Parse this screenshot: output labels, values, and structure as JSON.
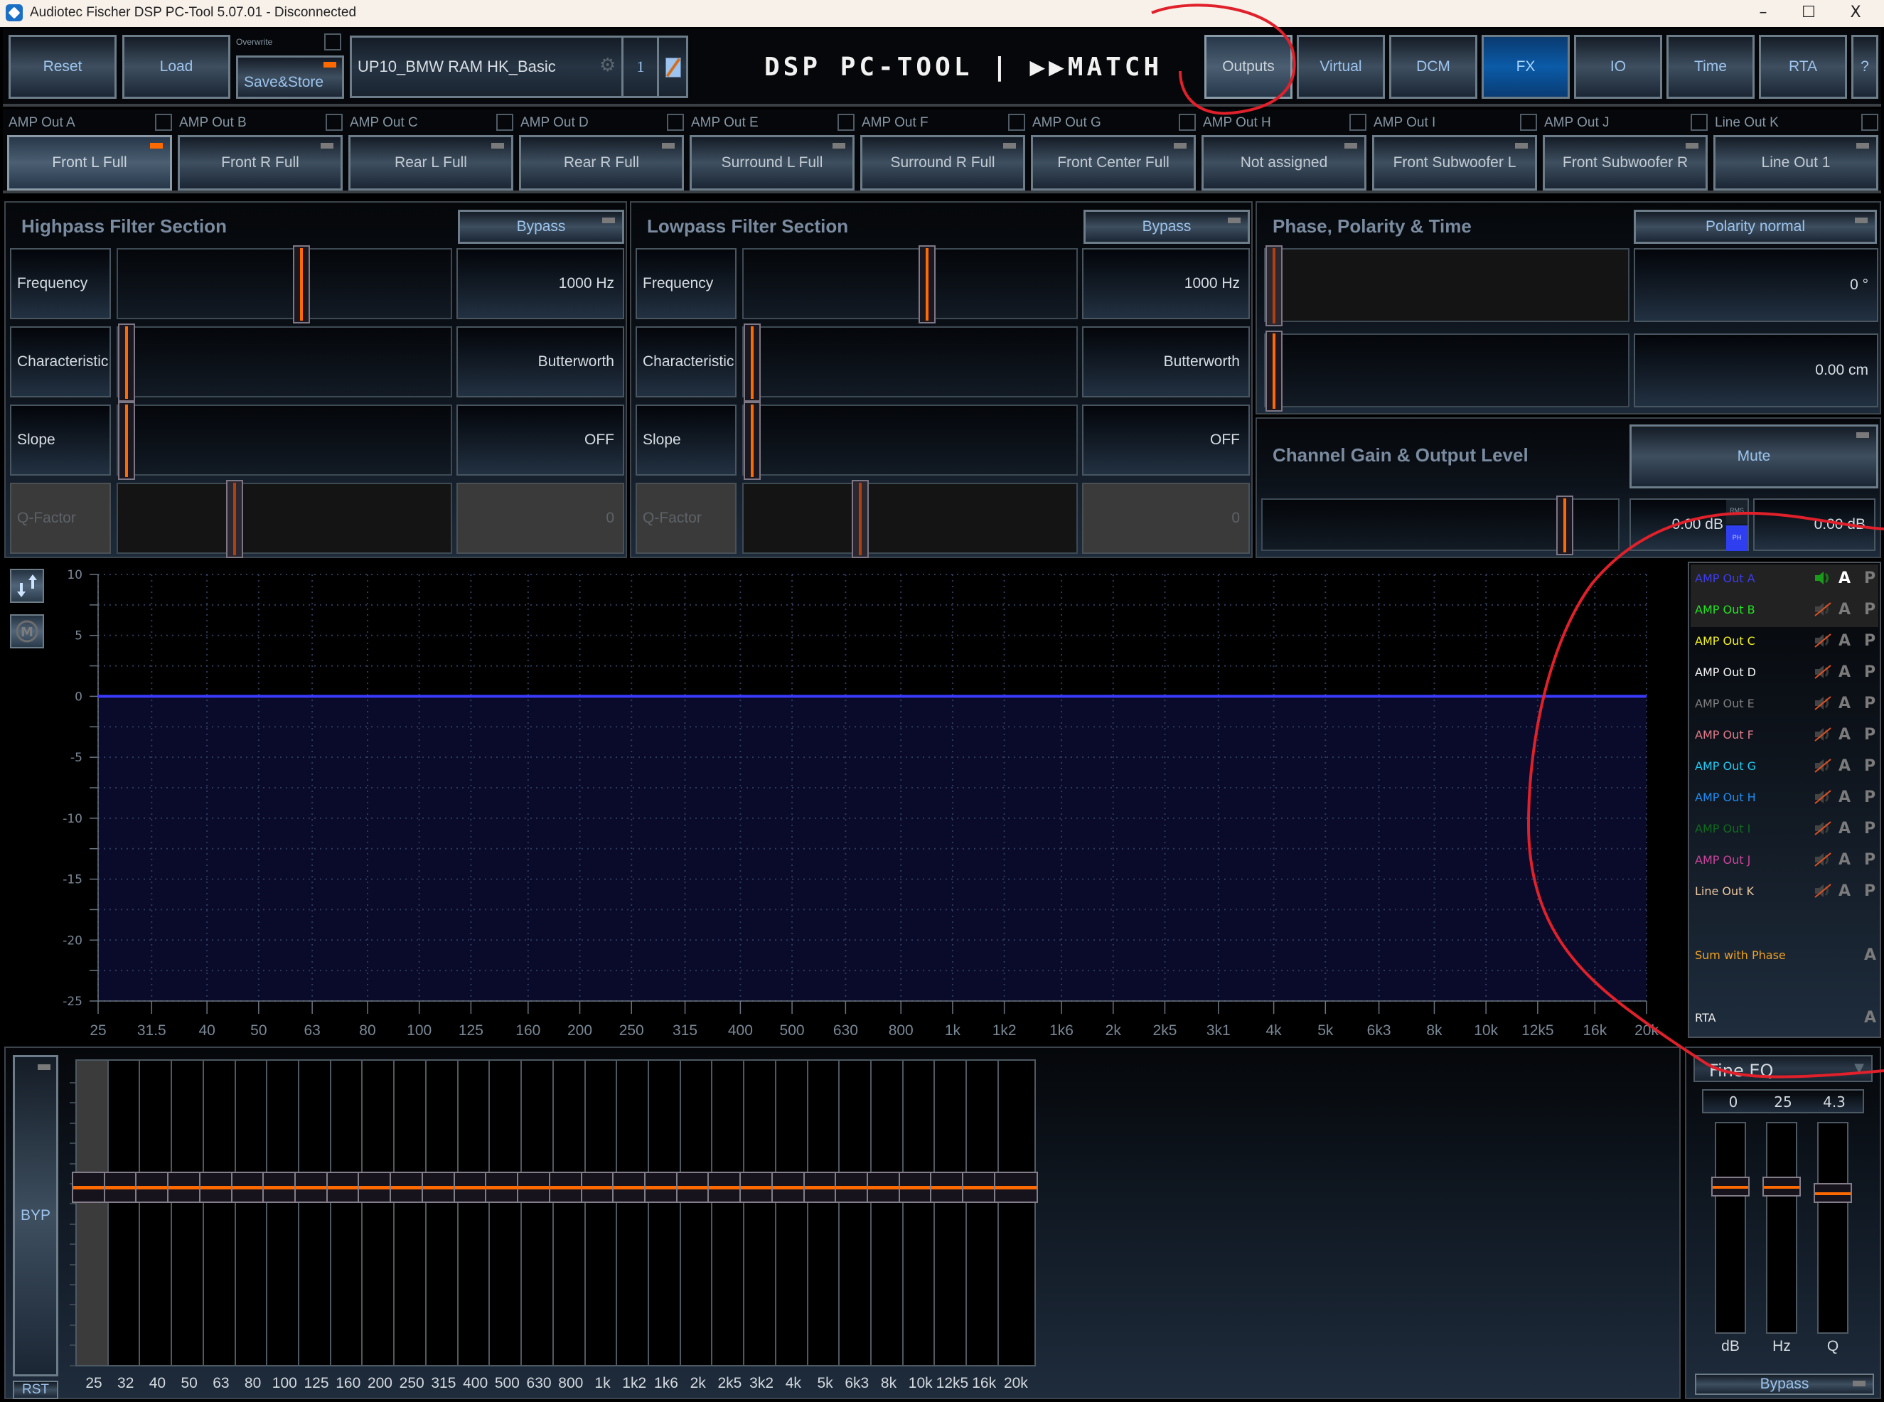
{
  "window": {
    "title": "Audiotec Fischer DSP PC-Tool 5.07.01 - Disconnected",
    "controls": {
      "minimize": "–",
      "maximize": "☐",
      "close": "X"
    }
  },
  "toolbar": {
    "reset": "Reset",
    "load": "Load",
    "overwrite_label": "Overwrite",
    "overwrite_checked": false,
    "save_store": "Save&Store",
    "setup_name": "UP10_BMW RAM HK_Basic",
    "setup_slot": "1",
    "logo": "DSP PC-TOOL | ▶▶MATCH",
    "nav": [
      {
        "label": "Outputs",
        "state": "selected"
      },
      {
        "label": "Virtual",
        "state": "normal"
      },
      {
        "label": "DCM",
        "state": "normal"
      },
      {
        "label": "FX",
        "state": "active"
      },
      {
        "label": "IO",
        "state": "normal"
      },
      {
        "label": "Time",
        "state": "normal"
      },
      {
        "label": "RTA",
        "state": "normal"
      },
      {
        "label": "?",
        "state": "normal"
      }
    ]
  },
  "channels": [
    {
      "output": "AMP Out A",
      "name": "Front L Full",
      "selected": true,
      "led": "on"
    },
    {
      "output": "AMP Out B",
      "name": "Front R Full",
      "selected": false,
      "led": "off"
    },
    {
      "output": "AMP Out C",
      "name": "Rear L Full",
      "selected": false,
      "led": "off"
    },
    {
      "output": "AMP Out D",
      "name": "Rear R Full",
      "selected": false,
      "led": "off"
    },
    {
      "output": "AMP Out E",
      "name": "Surround L Full",
      "selected": false,
      "led": "off"
    },
    {
      "output": "AMP Out F",
      "name": "Surround R Full",
      "selected": false,
      "led": "off"
    },
    {
      "output": "AMP Out G",
      "name": "Front Center Full",
      "selected": false,
      "led": "off"
    },
    {
      "output": "AMP Out H",
      "name": "Not assigned",
      "selected": false,
      "led": "off"
    },
    {
      "output": "AMP Out I",
      "name": "Front Subwoofer L",
      "selected": false,
      "led": "off"
    },
    {
      "output": "AMP Out J",
      "name": "Front Subwoofer R",
      "selected": false,
      "led": "off"
    },
    {
      "output": "Line Out K",
      "name": "Line Out 1",
      "selected": false,
      "led": "off"
    }
  ],
  "highpass": {
    "title": "Highpass Filter Section",
    "bypass": "Bypass",
    "rows": [
      {
        "label": "Frequency",
        "value": "1000 Hz",
        "position": 0.55,
        "disabled": false
      },
      {
        "label": "Characteristic",
        "value": "Butterworth",
        "position": 0.0,
        "disabled": false
      },
      {
        "label": "Slope",
        "value": "OFF",
        "position": 0.0,
        "disabled": false
      },
      {
        "label": "Q-Factor",
        "value": "0",
        "position": 0.34,
        "disabled": true
      }
    ]
  },
  "lowpass": {
    "title": "Lowpass Filter Section",
    "bypass": "Bypass",
    "rows": [
      {
        "label": "Frequency",
        "value": "1000 Hz",
        "position": 0.55,
        "disabled": false
      },
      {
        "label": "Characteristic",
        "value": "Butterworth",
        "position": 0.0,
        "disabled": false
      },
      {
        "label": "Slope",
        "value": "OFF",
        "position": 0.0,
        "disabled": false
      },
      {
        "label": "Q-Factor",
        "value": "0",
        "position": 0.34,
        "disabled": true
      }
    ]
  },
  "phase": {
    "title": "Phase, Polarity & Time",
    "polarity": "Polarity normal",
    "phase_value": "0 °",
    "phase_position": 0.0,
    "delay_value": "0.00 cm",
    "delay_position": 0.0
  },
  "gain": {
    "title": "Channel Gain & Output Level",
    "mute": "Mute",
    "gain_position": 0.86,
    "gain_value": "0.00 dB",
    "rms_label": "RMS",
    "ph_label": "PH",
    "output_level": "0.00 dB"
  },
  "graph_tools": {
    "swap_icon": "swap-arrows-icon",
    "marker_icon": "marker-m-icon"
  },
  "chart_data": {
    "type": "line",
    "title": "",
    "xlabel": "",
    "ylabel": "",
    "xscale": "log",
    "xlim": [
      25,
      20000
    ],
    "ylim": [
      -25,
      10
    ],
    "grid": true,
    "yticks": [
      10,
      5,
      0,
      -5,
      -10,
      -15,
      -20,
      -25
    ],
    "xtick_values": [
      25,
      31.5,
      40,
      50,
      63,
      80,
      100,
      125,
      160,
      200,
      250,
      315,
      400,
      500,
      630,
      800,
      1000,
      1250,
      1600,
      2000,
      2500,
      3150,
      4000,
      5000,
      6300,
      8000,
      10000,
      12500,
      16000,
      20000
    ],
    "xtick_labels": [
      "25",
      "31.5",
      "40",
      "50",
      "63",
      "80",
      "100",
      "125",
      "160",
      "200",
      "250",
      "315",
      "400",
      "500",
      "630",
      "800",
      "1k",
      "1k2",
      "1k6",
      "2k",
      "2k5",
      "3k1",
      "4k",
      "5k",
      "6k3",
      "8k",
      "10k",
      "12k5",
      "16k",
      "20k"
    ],
    "series": [
      {
        "name": "AMP Out A",
        "color": "#3a3aff",
        "x": [
          25,
          20000
        ],
        "y": [
          0,
          0
        ],
        "fill_below": "#0a0a2a"
      }
    ]
  },
  "legend": {
    "rows": [
      {
        "name": "AMP Out A",
        "color": "#3c3cf0",
        "speaker": "on",
        "a_active": true,
        "has_p": true
      },
      {
        "name": "AMP Out B",
        "color": "#22e022",
        "speaker": "muted",
        "a_active": false,
        "has_p": true
      },
      {
        "name": "AMP Out C",
        "color": "#f0f022",
        "speaker": "muted",
        "a_active": false,
        "has_p": true
      },
      {
        "name": "AMP Out D",
        "color": "#f2f2f2",
        "speaker": "muted",
        "a_active": false,
        "has_p": true
      },
      {
        "name": "AMP Out E",
        "color": "#7e7e7e",
        "speaker": "muted",
        "a_active": false,
        "has_p": true
      },
      {
        "name": "AMP Out F",
        "color": "#e07a8a",
        "speaker": "muted",
        "a_active": false,
        "has_p": true
      },
      {
        "name": "AMP Out G",
        "color": "#22c8f0",
        "speaker": "muted",
        "a_active": false,
        "has_p": true
      },
      {
        "name": "AMP Out H",
        "color": "#1e8cf0",
        "speaker": "muted",
        "a_active": false,
        "has_p": true
      },
      {
        "name": "AMP Out I",
        "color": "#0f6a1e",
        "speaker": "muted",
        "a_active": false,
        "has_p": true
      },
      {
        "name": "AMP Out J",
        "color": "#c8449a",
        "speaker": "muted",
        "a_active": false,
        "has_p": true
      },
      {
        "name": "Line Out K",
        "color": "#f0c8a0",
        "speaker": "muted",
        "a_active": false,
        "has_p": true
      }
    ],
    "sum_with_phase": {
      "name": "Sum with Phase",
      "color": "#f0a020"
    },
    "rta": {
      "name": "RTA",
      "color": "#f2f2f2"
    },
    "a_label": "A",
    "p_label": "P"
  },
  "graphic_eq": {
    "bypass": "BYP",
    "reset": "RST",
    "selected_band": "25",
    "bands": [
      {
        "label": "25",
        "gain_db": 0
      },
      {
        "label": "32",
        "gain_db": 0
      },
      {
        "label": "40",
        "gain_db": 0
      },
      {
        "label": "50",
        "gain_db": 0
      },
      {
        "label": "63",
        "gain_db": 0
      },
      {
        "label": "80",
        "gain_db": 0
      },
      {
        "label": "100",
        "gain_db": 0
      },
      {
        "label": "125",
        "gain_db": 0
      },
      {
        "label": "160",
        "gain_db": 0
      },
      {
        "label": "200",
        "gain_db": 0
      },
      {
        "label": "250",
        "gain_db": 0
      },
      {
        "label": "315",
        "gain_db": 0
      },
      {
        "label": "400",
        "gain_db": 0
      },
      {
        "label": "500",
        "gain_db": 0
      },
      {
        "label": "630",
        "gain_db": 0
      },
      {
        "label": "800",
        "gain_db": 0
      },
      {
        "label": "1k",
        "gain_db": 0
      },
      {
        "label": "1k2",
        "gain_db": 0
      },
      {
        "label": "1k6",
        "gain_db": 0
      },
      {
        "label": "2k",
        "gain_db": 0
      },
      {
        "label": "2k5",
        "gain_db": 0
      },
      {
        "label": "3k2",
        "gain_db": 0
      },
      {
        "label": "4k",
        "gain_db": 0
      },
      {
        "label": "5k",
        "gain_db": 0
      },
      {
        "label": "6k3",
        "gain_db": 0
      },
      {
        "label": "8k",
        "gain_db": 0
      },
      {
        "label": "10k",
        "gain_db": 0
      },
      {
        "label": "12k5",
        "gain_db": 0
      },
      {
        "label": "16k",
        "gain_db": 0
      },
      {
        "label": "20k",
        "gain_db": 0
      }
    ],
    "gain_range_db": [
      -15,
      15
    ]
  },
  "fine_eq": {
    "mode": "Fine EQ",
    "values": {
      "db": "0",
      "hz": "25",
      "q": "4.3"
    },
    "labels": {
      "db": "dB",
      "hz": "Hz",
      "q": "Q"
    },
    "positions": {
      "db": 0.5,
      "hz": 0.5,
      "q": 0.47
    },
    "bypass": "Bypass"
  }
}
